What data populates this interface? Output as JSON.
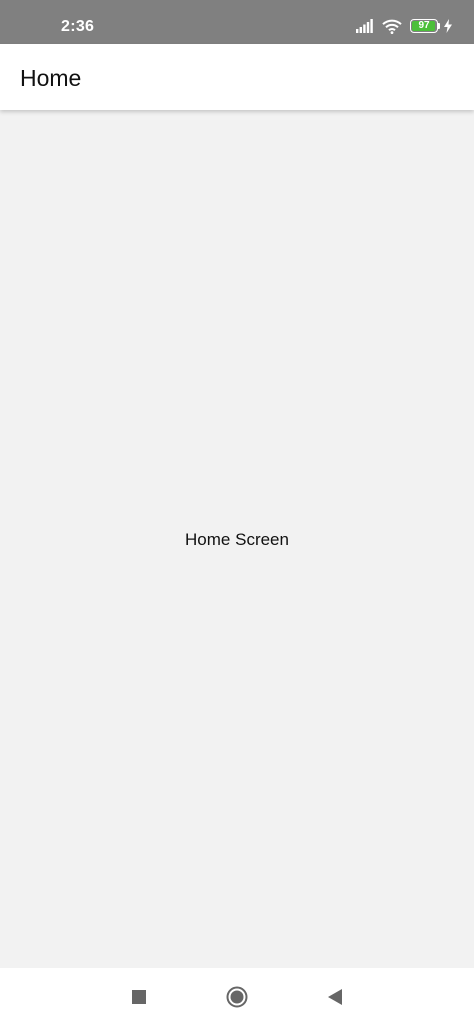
{
  "status_bar": {
    "time": "2:36",
    "battery_level": "97",
    "battery_fraction": 0.97,
    "icons": [
      "signal-icon",
      "wifi-icon",
      "battery-icon",
      "charging-bolt-icon"
    ],
    "colors": {
      "background": "#808080",
      "battery_fill": "#4cbf3a"
    }
  },
  "app_bar": {
    "title": "Home"
  },
  "content": {
    "text": "Home Screen"
  },
  "nav_bar": {
    "buttons": [
      "recents-square-icon",
      "home-circle-icon",
      "back-triangle-icon"
    ]
  }
}
